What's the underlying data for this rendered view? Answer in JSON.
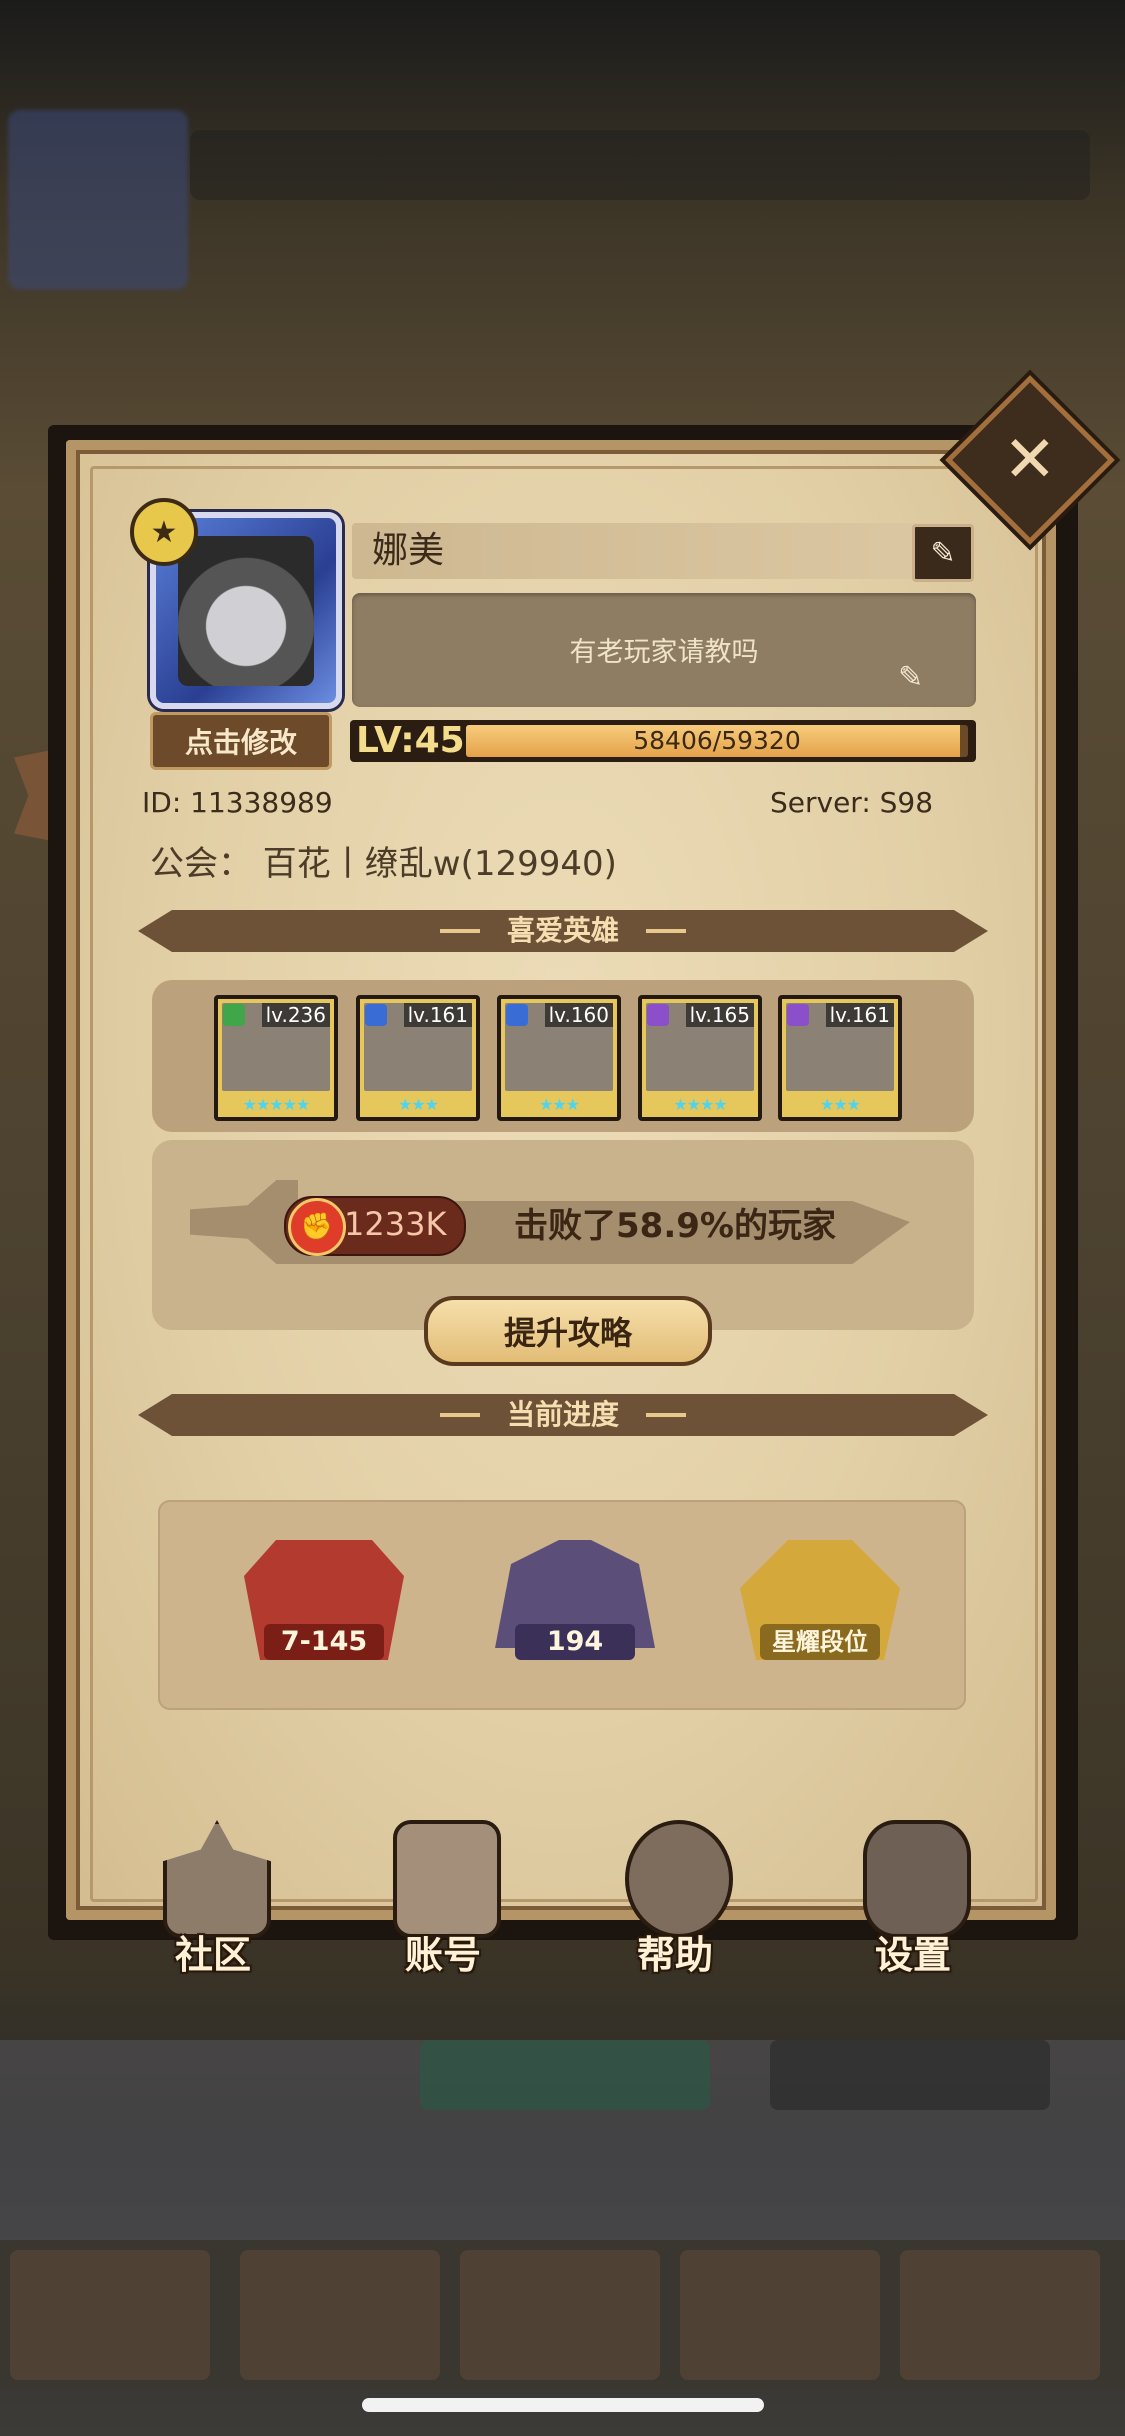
{
  "profile": {
    "name": "娜美",
    "signature": "有老玩家请教吗",
    "edit_avatar_label": "点击修改",
    "level_label": "LV:45",
    "exp_text": "58406/59320",
    "exp_current": 58406,
    "exp_max": 59320,
    "id_text": "ID:  11338989",
    "server_text": "Server:  S98",
    "guild_text": "公会：  百花丨缭乱w(129940)"
  },
  "sections": {
    "favorite_heroes": "喜爱英雄",
    "current_progress": "当前进度"
  },
  "heroes": [
    {
      "level": "lv.236",
      "class_color": "#3fa64a",
      "stars": "★★★★★"
    },
    {
      "level": "lv.161",
      "class_color": "#3a6cd6",
      "stars": "★★★"
    },
    {
      "level": "lv.160",
      "class_color": "#3a6cd6",
      "stars": "★★★"
    },
    {
      "level": "lv.165",
      "class_color": "#8a4fc9",
      "stars": "★★★★"
    },
    {
      "level": "lv.161",
      "class_color": "#8a4fc9",
      "stars": "★★★"
    }
  ],
  "power": {
    "value": "1233K",
    "defeat_text": "击败了58.9%的玩家",
    "strategy_button": "提升攻略"
  },
  "progress": [
    {
      "label": "7-145",
      "icon": "campaign-book-icon"
    },
    {
      "label": "194",
      "icon": "tower-icon"
    },
    {
      "label": "星耀段位",
      "icon": "arena-rank-icon"
    }
  ],
  "nav": [
    {
      "label": "社区",
      "icon": "castle-icon"
    },
    {
      "label": "账号",
      "icon": "account-card-icon"
    },
    {
      "label": "帮助",
      "icon": "chat-bubble-icon"
    },
    {
      "label": "设置",
      "icon": "gear-icon"
    }
  ],
  "colors": {
    "parchment": "#e2cfa6",
    "banner": "#6e5238",
    "exp_fill": "#e4a24a",
    "power_red": "#e03c2a"
  }
}
